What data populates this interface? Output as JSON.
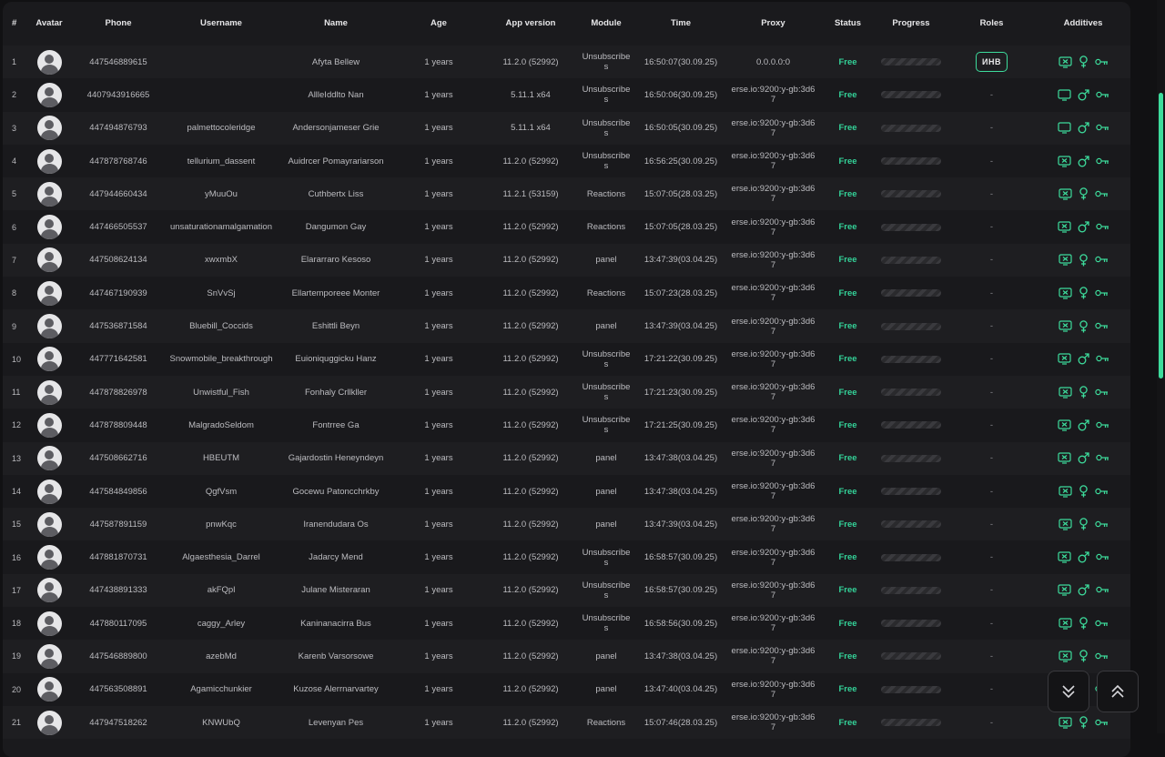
{
  "headers": {
    "num": "#",
    "avatar": "Avatar",
    "phone": "Phone",
    "username": "Username",
    "name": "Name",
    "age": "Age",
    "app": "App version",
    "module": "Module",
    "time": "Time",
    "proxy": "Proxy",
    "status": "Status",
    "progress": "Progress",
    "roles": "Roles",
    "additives": "Additives"
  },
  "accent_color": "#3ddc9c",
  "rows": [
    {
      "num": "1",
      "phone": "447546889615",
      "username": "",
      "name": "Afyta Bellew",
      "age": "1 years",
      "app": "11.2.0 (52992)",
      "module": "Unsubscribes",
      "time": "16:50:07(30.09.25)",
      "proxy": "0.0.0.0:0",
      "status": "Free",
      "role": "ИНВ",
      "icon1": "computer-x-icon",
      "icon2": "female-icon",
      "icon3": "key-icon"
    },
    {
      "num": "2",
      "phone": "4407943916665",
      "username": "",
      "name": "AllleIddlto Nan",
      "age": "1 years",
      "app": "5.11.1 x64",
      "module": "Unsubscribes",
      "time": "16:50:06(30.09.25)",
      "proxy": "erse.io:9200:y-gb:3d67",
      "status": "Free",
      "role": "-",
      "icon1": "monitor-icon",
      "icon2": "male-icon",
      "icon3": "key-icon"
    },
    {
      "num": "3",
      "phone": "447494876793",
      "username": "palmettocoleridge",
      "name": "Andersonjameser Grie",
      "age": "1 years",
      "app": "5.11.1 x64",
      "module": "Unsubscribes",
      "time": "16:50:05(30.09.25)",
      "proxy": "erse.io:9200:y-gb:3d67",
      "status": "Free",
      "role": "-",
      "icon1": "monitor-icon",
      "icon2": "male-icon",
      "icon3": "key-icon"
    },
    {
      "num": "4",
      "phone": "447878768746",
      "username": "tellurium_dassent",
      "name": "Auidrcer Pomayrariarson",
      "age": "1 years",
      "app": "11.2.0 (52992)",
      "module": "Unsubscribes",
      "time": "16:56:25(30.09.25)",
      "proxy": "erse.io:9200:y-gb:3d67",
      "status": "Free",
      "role": "-",
      "icon1": "computer-x-icon",
      "icon2": "male-icon",
      "icon3": "key-icon"
    },
    {
      "num": "5",
      "phone": "447944660434",
      "username": "yMuuOu",
      "name": "Cuthbertx Liss",
      "age": "1 years",
      "app": "11.2.1 (53159)",
      "module": "Reactions",
      "time": "15:07:05(28.03.25)",
      "proxy": "erse.io:9200:y-gb:3d67",
      "status": "Free",
      "role": "-",
      "icon1": "computer-x-icon",
      "icon2": "female-icon",
      "icon3": "key-icon"
    },
    {
      "num": "6",
      "phone": "447466505537",
      "username": "unsaturationamalgamation",
      "name": "Dangumon Gay",
      "age": "1 years",
      "app": "11.2.0 (52992)",
      "module": "Reactions",
      "time": "15:07:05(28.03.25)",
      "proxy": "erse.io:9200:y-gb:3d67",
      "status": "Free",
      "role": "-",
      "icon1": "computer-x-icon",
      "icon2": "male-icon",
      "icon3": "key-icon"
    },
    {
      "num": "7",
      "phone": "447508624134",
      "username": "xwxmbX",
      "name": "Elararraro Kesoso",
      "age": "1 years",
      "app": "11.2.0 (52992)",
      "module": "panel",
      "time": "13:47:39(03.04.25)",
      "proxy": "erse.io:9200:y-gb:3d67",
      "status": "Free",
      "role": "-",
      "icon1": "computer-x-icon",
      "icon2": "female-icon",
      "icon3": "key-icon"
    },
    {
      "num": "8",
      "phone": "447467190939",
      "username": "SnVvSj",
      "name": "Ellartemporeee Monter",
      "age": "1 years",
      "app": "11.2.0 (52992)",
      "module": "Reactions",
      "time": "15:07:23(28.03.25)",
      "proxy": "erse.io:9200:y-gb:3d67",
      "status": "Free",
      "role": "-",
      "icon1": "computer-x-icon",
      "icon2": "female-icon",
      "icon3": "key-icon"
    },
    {
      "num": "9",
      "phone": "447536871584",
      "username": "Bluebill_Coccids",
      "name": "Eshittli Beyn",
      "age": "1 years",
      "app": "11.2.0 (52992)",
      "module": "panel",
      "time": "13:47:39(03.04.25)",
      "proxy": "erse.io:9200:y-gb:3d67",
      "status": "Free",
      "role": "-",
      "icon1": "computer-x-icon",
      "icon2": "female-icon",
      "icon3": "key-icon"
    },
    {
      "num": "10",
      "phone": "447771642581",
      "username": "Snowmobile_breakthrough",
      "name": "Euioniquggicku Hanz",
      "age": "1 years",
      "app": "11.2.0 (52992)",
      "module": "Unsubscribes",
      "time": "17:21:22(30.09.25)",
      "proxy": "erse.io:9200:y-gb:3d67",
      "status": "Free",
      "role": "-",
      "icon1": "computer-x-icon",
      "icon2": "male-icon",
      "icon3": "key-icon"
    },
    {
      "num": "11",
      "phone": "447878826978",
      "username": "Unwistful_Fish",
      "name": "Fonhaly Crllkller",
      "age": "1 years",
      "app": "11.2.0 (52992)",
      "module": "Unsubscribes",
      "time": "17:21:23(30.09.25)",
      "proxy": "erse.io:9200:y-gb:3d67",
      "status": "Free",
      "role": "-",
      "icon1": "computer-x-icon",
      "icon2": "female-icon",
      "icon3": "key-icon"
    },
    {
      "num": "12",
      "phone": "447878809448",
      "username": "MalgradoSeldom",
      "name": "Fontrree Ga",
      "age": "1 years",
      "app": "11.2.0 (52992)",
      "module": "Unsubscribes",
      "time": "17:21:25(30.09.25)",
      "proxy": "erse.io:9200:y-gb:3d67",
      "status": "Free",
      "role": "-",
      "icon1": "computer-x-icon",
      "icon2": "male-icon",
      "icon3": "key-icon"
    },
    {
      "num": "13",
      "phone": "447508662716",
      "username": "HBEUTM",
      "name": "Gajardostin Heneyndeyn",
      "age": "1 years",
      "app": "11.2.0 (52992)",
      "module": "panel",
      "time": "13:47:38(03.04.25)",
      "proxy": "erse.io:9200:y-gb:3d67",
      "status": "Free",
      "role": "-",
      "icon1": "computer-x-icon",
      "icon2": "male-icon",
      "icon3": "key-icon"
    },
    {
      "num": "14",
      "phone": "447584849856",
      "username": "QgfVsm",
      "name": "Gocewu Patoncchrkby",
      "age": "1 years",
      "app": "11.2.0 (52992)",
      "module": "panel",
      "time": "13:47:38(03.04.25)",
      "proxy": "erse.io:9200:y-gb:3d67",
      "status": "Free",
      "role": "-",
      "icon1": "computer-x-icon",
      "icon2": "female-icon",
      "icon3": "key-icon"
    },
    {
      "num": "15",
      "phone": "447587891159",
      "username": "pnwKqc",
      "name": "Iranendudara Os",
      "age": "1 years",
      "app": "11.2.0 (52992)",
      "module": "panel",
      "time": "13:47:39(03.04.25)",
      "proxy": "erse.io:9200:y-gb:3d67",
      "status": "Free",
      "role": "-",
      "icon1": "computer-x-icon",
      "icon2": "female-icon",
      "icon3": "key-icon"
    },
    {
      "num": "16",
      "phone": "447881870731",
      "username": "Algaesthesia_Darrel",
      "name": "Jadarcy Mend",
      "age": "1 years",
      "app": "11.2.0 (52992)",
      "module": "Unsubscribes",
      "time": "16:58:57(30.09.25)",
      "proxy": "erse.io:9200:y-gb:3d67",
      "status": "Free",
      "role": "-",
      "icon1": "computer-x-icon",
      "icon2": "male-icon",
      "icon3": "key-icon"
    },
    {
      "num": "17",
      "phone": "447438891333",
      "username": "akFQpl",
      "name": "Julane Misteraran",
      "age": "1 years",
      "app": "11.2.0 (52992)",
      "module": "Unsubscribes",
      "time": "16:58:57(30.09.25)",
      "proxy": "erse.io:9200:y-gb:3d67",
      "status": "Free",
      "role": "-",
      "icon1": "computer-x-icon",
      "icon2": "male-icon",
      "icon3": "key-icon"
    },
    {
      "num": "18",
      "phone": "447880117095",
      "username": "caggy_Arley",
      "name": "Kaninanacirra Bus",
      "age": "1 years",
      "app": "11.2.0 (52992)",
      "module": "Unsubscribes",
      "time": "16:58:56(30.09.25)",
      "proxy": "erse.io:9200:y-gb:3d67",
      "status": "Free",
      "role": "-",
      "icon1": "computer-x-icon",
      "icon2": "female-icon",
      "icon3": "key-icon"
    },
    {
      "num": "19",
      "phone": "447546889800",
      "username": "azebMd",
      "name": "Karenb Varsorsowe",
      "age": "1 years",
      "app": "11.2.0 (52992)",
      "module": "panel",
      "time": "13:47:38(03.04.25)",
      "proxy": "erse.io:9200:y-gb:3d67",
      "status": "Free",
      "role": "-",
      "icon1": "computer-x-icon",
      "icon2": "female-icon",
      "icon3": "key-icon"
    },
    {
      "num": "20",
      "phone": "447563508891",
      "username": "Agamicchunkier",
      "name": "Kuzose Alerrnarvartey",
      "age": "1 years",
      "app": "11.2.0 (52992)",
      "module": "panel",
      "time": "13:47:40(03.04.25)",
      "proxy": "erse.io:9200:y-gb:3d67",
      "status": "Free",
      "role": "-",
      "icon1": "computer-x-icon",
      "icon2": "female-icon",
      "icon3": "key-icon"
    },
    {
      "num": "21",
      "phone": "447947518262",
      "username": "KNWUbQ",
      "name": "Levenyan Pes",
      "age": "1 years",
      "app": "11.2.0 (52992)",
      "module": "Reactions",
      "time": "15:07:46(28.03.25)",
      "proxy": "erse.io:9200:y-gb:3d67",
      "status": "Free",
      "role": "-",
      "icon1": "computer-x-icon",
      "icon2": "female-icon",
      "icon3": "key-icon"
    }
  ],
  "fab": {
    "down_icon": "chevrons-down-icon",
    "up_icon": "chevrons-up-icon"
  }
}
